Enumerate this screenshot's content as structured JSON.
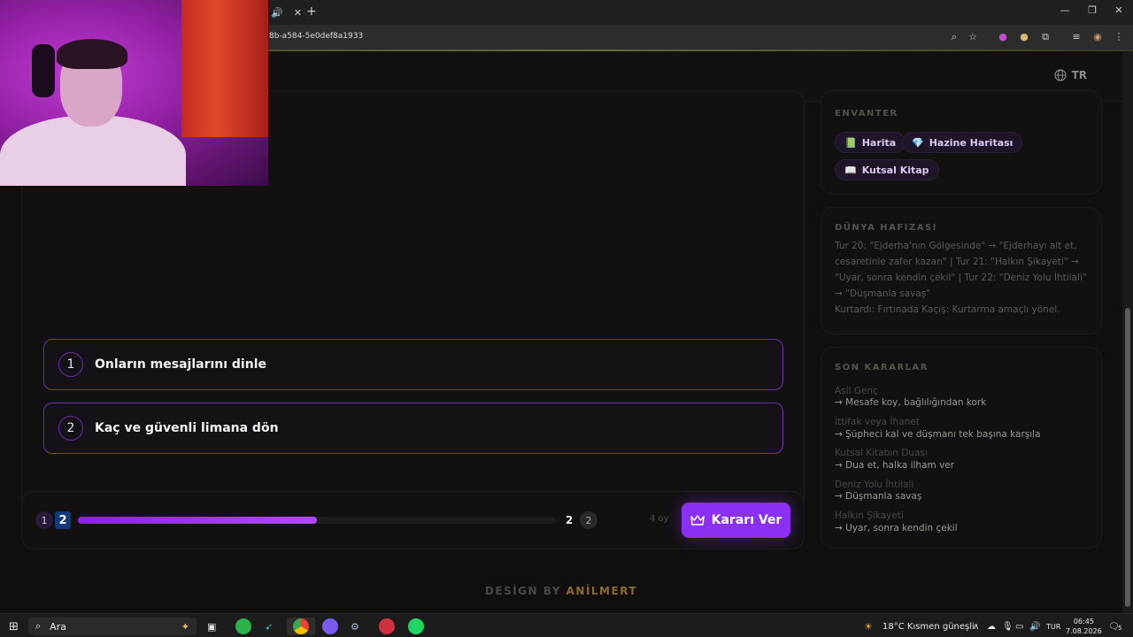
{
  "browser": {
    "url": "8b-a584-5e0def8a1933",
    "tab_audio_icon": "speaker-icon",
    "tab_close": "✕",
    "new_tab": "+"
  },
  "header": {
    "lang": "TR"
  },
  "choices": [
    {
      "num": "1",
      "text": "Onların mesajlarını dinle"
    },
    {
      "num": "2",
      "text": "Kaç ve güvenli limana dön"
    }
  ],
  "progress": {
    "start_step": "1",
    "current_step": "2",
    "end_label": "2",
    "end_step": "2",
    "fraction": 0.5,
    "votes": "4 oy",
    "button_label": "Kararı Ver"
  },
  "inventory": {
    "title": "ENVANTER",
    "items": [
      {
        "icon": "📗",
        "label": "Harita"
      },
      {
        "icon": "💎",
        "label": "Hazine Haritası"
      },
      {
        "icon": "📖",
        "label": "Kutsal Kitap"
      }
    ]
  },
  "memory": {
    "title": "DÜNYA HAFIZASI",
    "text": "Tur 20: \"Ejderha'nın Gölgesinde\" → \"Ejderhayı alt et, cesaretinle zafer kazan\" | Tur 21: \"Halkın Şikayeti\" → \"Uyar, sonra kendin çekil\" | Tur 22: \"Deniz Yolu İhtilali\" → \"Düşmanla savaş\"",
    "text2": "Kurtardı: Fırtınada Kaçış: Kurtarma amaçlı yönel."
  },
  "decisions": {
    "title": "SON KARARLAR",
    "items": [
      {
        "q": "Asil Genç",
        "a": "→ Mesafe koy, bağlılığından kork"
      },
      {
        "q": "İttifak veya İhanet",
        "a": "→ Şüpheci kal ve düşmanı tek başına karşıla"
      },
      {
        "q": "Kutsal Kitabın Duası",
        "a": "→ Dua et, halka ilham ver"
      },
      {
        "q": "Deniz Yolu İhtilali",
        "a": "→ Düşmanla savaş"
      },
      {
        "q": "Halkın Şikayeti",
        "a": "→ Uyar, sonra kendin çekil"
      }
    ]
  },
  "footer": {
    "prefix": "DESİGN BY ",
    "name": "ANİLMERT"
  },
  "taskbar": {
    "search": "Ara",
    "weather": "18°C  Kısmen güneşli",
    "lang": "TUR",
    "time": "06:45",
    "date": "7.08.2026",
    "notif": "5"
  },
  "colors": {
    "accent": "#8b2ff2",
    "choice_border": "#6b2fb0",
    "footer_name": "#8a6a2a"
  }
}
